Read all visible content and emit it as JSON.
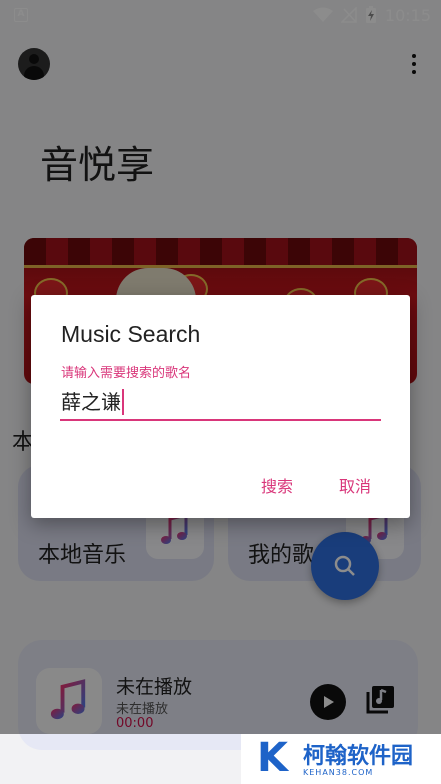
{
  "status_bar": {
    "time": "10:15",
    "app_icon_letter": "A"
  },
  "header": {
    "title": "音悦享"
  },
  "section": {
    "title": "本"
  },
  "cards": [
    {
      "label": "本地音乐",
      "icon": "music-note-icon"
    },
    {
      "label": "我的歌",
      "icon": "music-note-icon"
    }
  ],
  "player": {
    "title": "未在播放",
    "subtitle": "未在播放",
    "time": "00:00"
  },
  "dialog": {
    "title": "Music Search",
    "field_label": "请输入需要搜索的歌名",
    "field_value": "薛之谦",
    "search_label": "搜索",
    "cancel_label": "取消"
  },
  "watermark": {
    "brand": "柯翰软件园",
    "url": "KEHAN38.COM",
    "logo": "K"
  },
  "colors": {
    "accent": "#d9367a",
    "fab": "#2f6fe0",
    "time": "#d0104a",
    "watermark": "#1e63c8"
  }
}
